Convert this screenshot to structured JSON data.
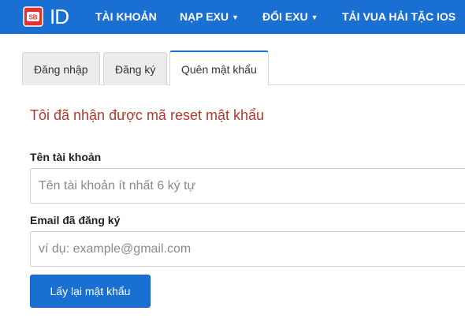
{
  "brand": {
    "logo_text": "ID",
    "badge_text": "SB",
    "accent_color": "#1a6fd3",
    "badge_color": "#e5322d"
  },
  "nav": {
    "items": [
      {
        "label": "TÀI KHOẢN",
        "has_dropdown": false
      },
      {
        "label": "NẠP EXU",
        "has_dropdown": true
      },
      {
        "label": "ĐỔI EXU",
        "has_dropdown": true
      },
      {
        "label": "TẢI VUA HẢI TẶC IOS",
        "has_dropdown": false
      }
    ]
  },
  "tabs": [
    {
      "label": "Đăng nhập",
      "active": false
    },
    {
      "label": "Đăng ký",
      "active": false
    },
    {
      "label": "Quên mật khẩu",
      "active": true
    }
  ],
  "form": {
    "notice": "Tôi đã nhận được mã reset mật khẩu",
    "username_label": "Tên tài khoản",
    "username_placeholder": "Tên tài khoản ít nhất 6 ký tự",
    "email_label": "Email đã đăng ký",
    "email_placeholder": "ví dụ: example@gmail.com",
    "submit_label": "Lấy lại mật khẩu"
  }
}
